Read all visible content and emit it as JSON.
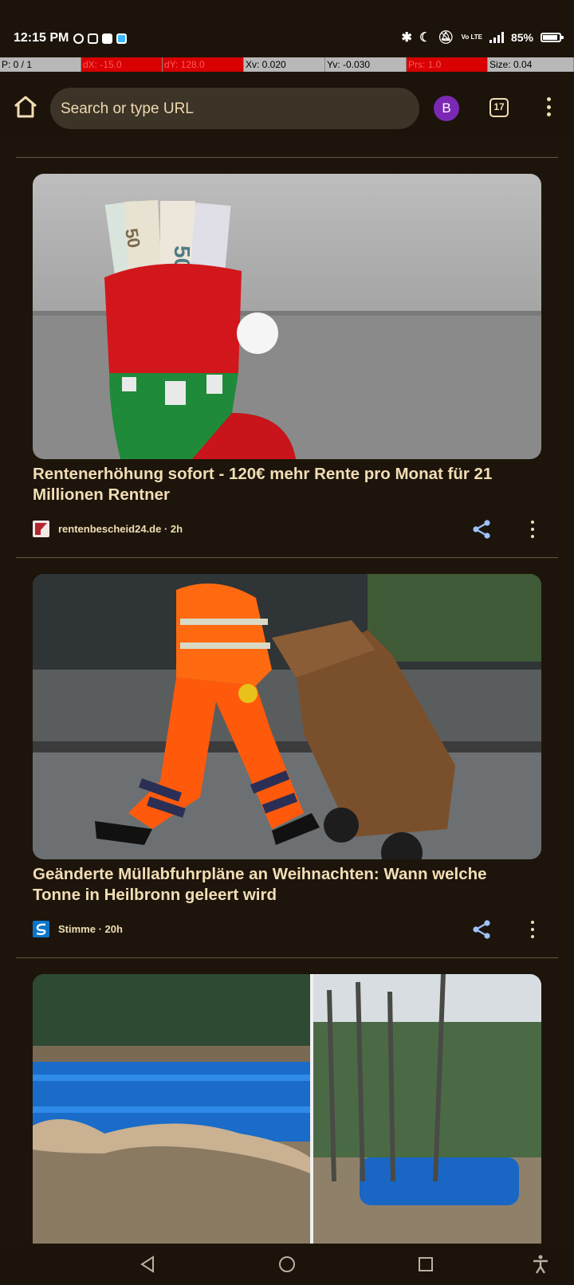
{
  "status": {
    "time": "12:15 PM",
    "battery": "85%",
    "network": "4G",
    "volte": "Vo LTE"
  },
  "debug": [
    "P: 0 / 1",
    "dX: -15.0",
    "dY: 128.0",
    "Xv: 0.020",
    "Yv: -0.030",
    "Prs: 1.0",
    "Size: 0.04"
  ],
  "toolbar": {
    "url_placeholder": "Search or type URL",
    "avatar_letter": "B",
    "tab_count": "17"
  },
  "articles": [
    {
      "title": "Rentenerhöhung sofort - 120€ mehr Rente pro Monat für 21 Millionen Rentner",
      "meta": "rentenbescheid24.de · 2h",
      "image": "christmas-stocking-with-euro-bills"
    },
    {
      "title": "Geänderte Müllabfuhrpläne an Weihnachten: Wann welche Tonne in Heilbronn geleert wird",
      "meta": "Stimme · 20h",
      "image": "worker-pulling-brown-waste-bin"
    },
    {
      "title": "",
      "meta": "",
      "image": "python-on-blue-barrels-in-flood"
    }
  ],
  "colors": {
    "background": "#1d150b",
    "text": "#f2ddb6",
    "accent_share": "#9cc2ff",
    "avatar": "#7b28b4"
  }
}
